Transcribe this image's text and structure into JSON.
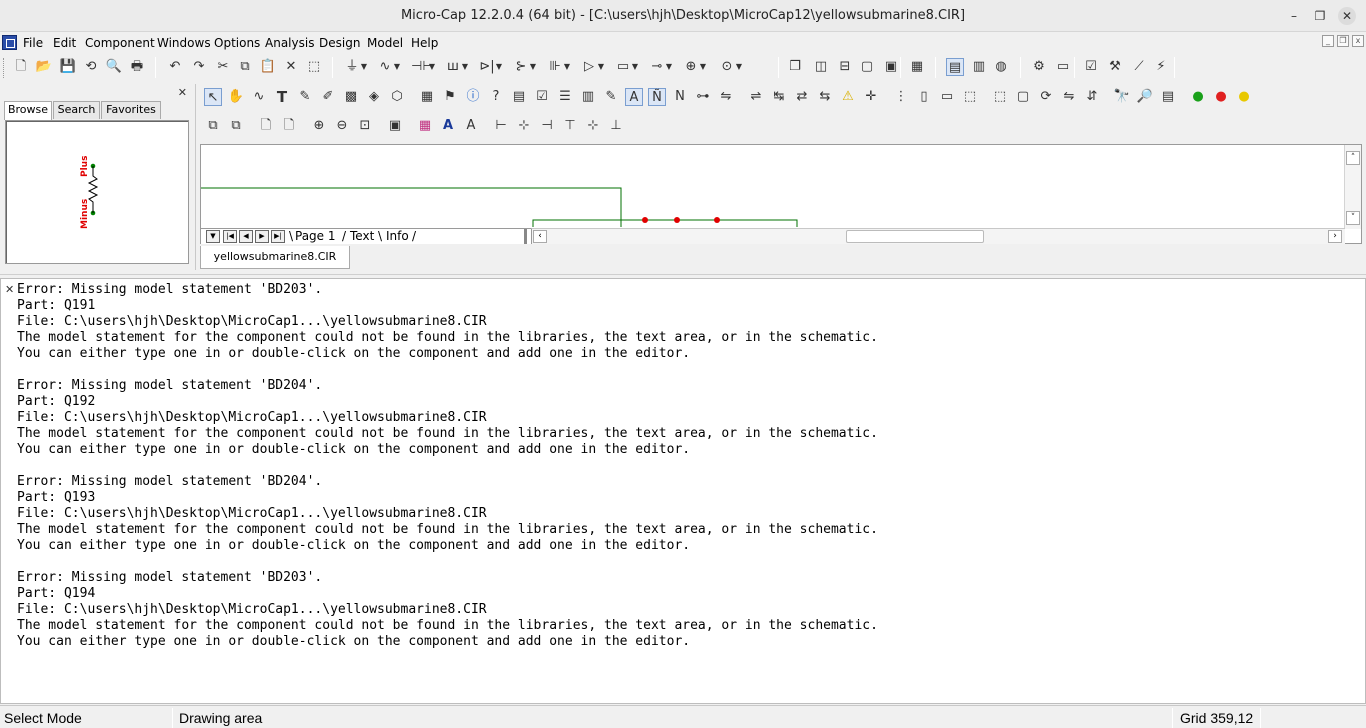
{
  "window": {
    "title": "Micro-Cap 12.2.0.4 (64 bit) - [C:\\users\\hjh\\Desktop\\MicroCap12\\yellowsubmarine8.CIR]",
    "minimize_glyph": "–",
    "maximize_glyph": "❐",
    "close_glyph": "✕"
  },
  "menu": {
    "items": [
      "File",
      "Edit",
      "Component",
      "Windows",
      "Options",
      "Analysis",
      "Design",
      "Model",
      "Help"
    ]
  },
  "browser": {
    "tabs": [
      "Browse",
      "Search",
      "Favorites"
    ],
    "active_tab": "Browse",
    "close_glyph": "✕",
    "preview": {
      "top_pin_label": "Plus",
      "bottom_pin_label": "Minus",
      "label_color": "#e00000",
      "pin_color": "#008000"
    }
  },
  "schematic": {
    "page_tabs": [
      "Page 1",
      "Text",
      "Info"
    ],
    "wire_color": "#007000",
    "node_color": "#e00000",
    "scroll_left_glyph": "‹",
    "scroll_right_glyph": "›",
    "scroll_up_glyph": "˄",
    "scroll_down_glyph": "˅"
  },
  "doc_tab": {
    "label": "yellowsubmarine8.CIR"
  },
  "output": {
    "pin_glyph": "✕",
    "messages": [
      {
        "error": "Error: Missing model statement 'BD203'.",
        "part": "Part: Q191",
        "file": "File: C:\\users\\hjh\\Desktop\\MicroCap1...\\yellowsubmarine8.CIR",
        "line1": "The model statement for the component could not be found in the libraries, the text area, or in the schematic.",
        "line2": "You can either type one in or double-click on the component and add one in the editor."
      },
      {
        "error": "Error: Missing model statement 'BD204'.",
        "part": "Part: Q192",
        "file": "File: C:\\users\\hjh\\Desktop\\MicroCap1...\\yellowsubmarine8.CIR",
        "line1": "The model statement for the component could not be found in the libraries, the text area, or in the schematic.",
        "line2": "You can either type one in or double-click on the component and add one in the editor."
      },
      {
        "error": "Error: Missing model statement 'BD204'.",
        "part": "Part: Q193",
        "file": "File: C:\\users\\hjh\\Desktop\\MicroCap1...\\yellowsubmarine8.CIR",
        "line1": "The model statement for the component could not be found in the libraries, the text area, or in the schematic.",
        "line2": "You can either type one in or double-click on the component and add one in the editor."
      },
      {
        "error": "Error: Missing model statement 'BD203'.",
        "part": "Part: Q194",
        "file": "File: C:\\users\\hjh\\Desktop\\MicroCap1...\\yellowsubmarine8.CIR",
        "line1": "The model statement for the component could not be found in the libraries, the text area, or in the schematic.",
        "line2": "You can either type one in or double-click on the component and add one in the editor."
      }
    ]
  },
  "statusbar": {
    "mode": "Select Mode",
    "hint": "Drawing area",
    "grid": "Grid 359,12"
  },
  "toolbar_main": {
    "icons": [
      {
        "name": "new-file-icon",
        "glyph": "🗋"
      },
      {
        "name": "open-folder-icon",
        "glyph": "📂"
      },
      {
        "name": "save-icon",
        "glyph": "💾"
      },
      {
        "name": "revert-icon",
        "glyph": "⟲"
      },
      {
        "name": "print-preview-icon",
        "glyph": "🔍"
      },
      {
        "name": "print-icon",
        "glyph": "🖶"
      },
      {
        "name": "undo-icon",
        "glyph": "↶"
      },
      {
        "name": "redo-icon",
        "glyph": "↷"
      },
      {
        "name": "cut-icon",
        "glyph": "✂"
      },
      {
        "name": "copy-icon",
        "glyph": "⧉"
      },
      {
        "name": "paste-icon",
        "glyph": "📋"
      },
      {
        "name": "delete-icon",
        "glyph": "✕"
      },
      {
        "name": "select-all-icon",
        "glyph": "⬚"
      },
      {
        "name": "ground-icon",
        "glyph": "⏚"
      },
      {
        "name": "resistor-icon",
        "glyph": "∿"
      },
      {
        "name": "capacitor-icon",
        "glyph": "⊣⊢"
      },
      {
        "name": "inductor-icon",
        "glyph": "ꟺ"
      },
      {
        "name": "diode-icon",
        "glyph": "⊳|"
      },
      {
        "name": "transistor-icon",
        "glyph": "⊱"
      },
      {
        "name": "battery-icon",
        "glyph": "⊪"
      },
      {
        "name": "opamp-icon",
        "glyph": "▷"
      },
      {
        "name": "macro-icon",
        "glyph": "▭"
      },
      {
        "name": "switch-icon",
        "glyph": "⊸"
      },
      {
        "name": "source-icon",
        "glyph": "⊕"
      },
      {
        "name": "probe-icon",
        "glyph": "⊙"
      },
      {
        "name": "cascade-windows-icon",
        "glyph": "❐"
      },
      {
        "name": "tile-vertical-icon",
        "glyph": "◫"
      },
      {
        "name": "tile-horizontal-icon",
        "glyph": "⊟"
      },
      {
        "name": "window-icon",
        "glyph": "▢"
      },
      {
        "name": "window-alt-icon",
        "glyph": "▣"
      },
      {
        "name": "calculator-icon",
        "glyph": "▦"
      },
      {
        "name": "component-panel-icon",
        "glyph": "▤"
      },
      {
        "name": "library-icon",
        "glyph": "▥"
      },
      {
        "name": "globe-icon",
        "glyph": "◍"
      },
      {
        "name": "analysis-icon",
        "glyph": "⚙"
      },
      {
        "name": "probe-panel-icon",
        "glyph": "▭"
      },
      {
        "name": "check-icon",
        "glyph": "☑"
      },
      {
        "name": "tools-icon",
        "glyph": "⚒"
      },
      {
        "name": "plot-icon",
        "glyph": "⟋"
      },
      {
        "name": "wizard-icon",
        "glyph": "⚡"
      }
    ]
  },
  "toolbar_palette": {
    "row1": [
      {
        "name": "select-mode-icon",
        "glyph": "↖"
      },
      {
        "name": "pan-icon",
        "glyph": "✋"
      },
      {
        "name": "wire-icon",
        "glyph": "∿"
      },
      {
        "name": "text-icon",
        "glyph": "T"
      },
      {
        "name": "wire-draw-icon",
        "glyph": "✎"
      },
      {
        "name": "pen-icon",
        "glyph": "✐"
      },
      {
        "name": "image-icon",
        "glyph": "▩"
      },
      {
        "name": "shape-icon",
        "glyph": "◈"
      },
      {
        "name": "graphic-icon",
        "glyph": "⬡"
      },
      {
        "name": "grid-table-icon",
        "glyph": "▦"
      },
      {
        "name": "flag-icon",
        "glyph": "⚑"
      },
      {
        "name": "info-icon",
        "glyph": "ⓘ"
      },
      {
        "name": "help-icon",
        "glyph": "?"
      },
      {
        "name": "attribute-icon",
        "glyph": "▤"
      },
      {
        "name": "checkbox-icon",
        "glyph": "☑"
      },
      {
        "name": "list-icon",
        "glyph": "☰"
      },
      {
        "name": "grid-icon",
        "glyph": "▥"
      },
      {
        "name": "edit-icon",
        "glyph": "✎"
      },
      {
        "name": "attribute-text-icon",
        "glyph": "A"
      },
      {
        "name": "node-numbers-icon",
        "glyph": "Ñ"
      },
      {
        "name": "pin-names-icon",
        "glyph": "N"
      },
      {
        "name": "tool-a-icon",
        "glyph": "⊶"
      },
      {
        "name": "tool-b-icon",
        "glyph": "⇋"
      },
      {
        "name": "tool-c-icon",
        "glyph": "⇌"
      },
      {
        "name": "tool-d-icon",
        "glyph": "↹"
      },
      {
        "name": "tool-e-icon",
        "glyph": "⇄"
      },
      {
        "name": "tool-f-icon",
        "glyph": "⇆"
      },
      {
        "name": "warning-icon",
        "glyph": "⚠"
      },
      {
        "name": "crosshair-icon",
        "glyph": "✛"
      },
      {
        "name": "grid-dots-icon",
        "glyph": "⋮"
      },
      {
        "name": "page-icon",
        "glyph": "▯"
      },
      {
        "name": "page-alt-icon",
        "glyph": "▭"
      },
      {
        "name": "bounds-icon",
        "glyph": "⬚"
      },
      {
        "name": "component-icon",
        "glyph": "⬚"
      },
      {
        "name": "select-region-icon",
        "glyph": "▢"
      },
      {
        "name": "rotate-icon",
        "glyph": "⟳"
      },
      {
        "name": "flip-h-icon",
        "glyph": "⇋"
      },
      {
        "name": "flip-v-icon",
        "glyph": "⇵"
      },
      {
        "name": "find-icon",
        "glyph": "🔭"
      },
      {
        "name": "find-next-icon",
        "glyph": "🔎"
      },
      {
        "name": "properties-icon",
        "glyph": "▤"
      },
      {
        "name": "run-icon",
        "glyph": "●"
      },
      {
        "name": "stop-icon",
        "glyph": "●"
      },
      {
        "name": "pause-icon",
        "glyph": "●"
      }
    ],
    "row2": [
      {
        "name": "group-icon",
        "glyph": "⧉"
      },
      {
        "name": "ungroup-icon",
        "glyph": "⧉"
      },
      {
        "name": "add-page-icon",
        "glyph": "🗋"
      },
      {
        "name": "delete-page-icon",
        "glyph": "🗋"
      },
      {
        "name": "zoom-in-icon",
        "glyph": "⊕"
      },
      {
        "name": "zoom-out-icon",
        "glyph": "⊖"
      },
      {
        "name": "zoom-fit-icon",
        "glyph": "⊡"
      },
      {
        "name": "camera-icon",
        "glyph": "▣"
      },
      {
        "name": "colors-icon",
        "glyph": "▦"
      },
      {
        "name": "font-icon",
        "glyph": "A"
      },
      {
        "name": "font-style-icon",
        "glyph": "A"
      },
      {
        "name": "align-left-icon",
        "glyph": "⊢"
      },
      {
        "name": "align-center-icon",
        "glyph": "⊹"
      },
      {
        "name": "align-right-icon",
        "glyph": "⊣"
      },
      {
        "name": "align-top-icon",
        "glyph": "⊤"
      },
      {
        "name": "align-middle-icon",
        "glyph": "⊹"
      },
      {
        "name": "align-bottom-icon",
        "glyph": "⊥"
      }
    ]
  }
}
